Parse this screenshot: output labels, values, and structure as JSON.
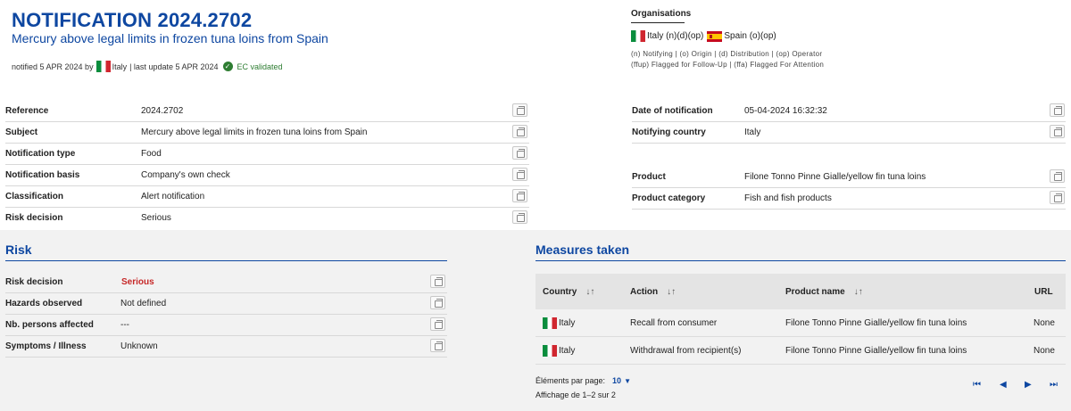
{
  "header": {
    "title": "NOTIFICATION 2024.2702",
    "subtitle": "Mercury above legal limits in frozen tuna loins from Spain",
    "notified_prefix": "notified 5 APR 2024 by",
    "notified_country": "Italy",
    "last_update": "| last update 5 APR 2024",
    "ec_validated": "EC validated"
  },
  "organisations": {
    "title": "Organisations",
    "entries": [
      {
        "country": "Italy",
        "roles": "(n)(d)(op)"
      },
      {
        "country": "Spain",
        "roles": "(o)(op)"
      }
    ],
    "legend_line1": "(n) Notifying | (o) Origin | (d) Distribution | (op) Operator",
    "legend_line2": "(ffup) Flagged for Follow-Up | (ffa) Flagged For Attention"
  },
  "details_left": [
    {
      "label": "Reference",
      "value": "2024.2702"
    },
    {
      "label": "Subject",
      "value": "Mercury above legal limits in frozen tuna loins from Spain"
    },
    {
      "label": "Notification type",
      "value": "Food"
    },
    {
      "label": "Notification basis",
      "value": "Company's own check"
    },
    {
      "label": "Classification",
      "value": "Alert notification"
    },
    {
      "label": "Risk decision",
      "value": "Serious"
    }
  ],
  "details_right": [
    {
      "label": "Date of notification",
      "value": "05-04-2024 16:32:32"
    },
    {
      "label": "Notifying country",
      "value": "Italy"
    },
    {
      "label": "Product",
      "value": "Filone Tonno Pinne Gialle/yellow fin tuna loins"
    },
    {
      "label": "Product category",
      "value": "Fish and fish products"
    }
  ],
  "risk": {
    "title": "Risk",
    "rows": [
      {
        "label": "Risk decision",
        "value": "Serious"
      },
      {
        "label": "Hazards observed",
        "value": "Not defined"
      },
      {
        "label": "Nb. persons affected",
        "value": "---"
      },
      {
        "label": "Symptoms / Illness",
        "value": "Unknown"
      }
    ]
  },
  "measures": {
    "title": "Measures taken",
    "columns": [
      "Country",
      "Action",
      "Product name",
      "URL"
    ],
    "rows": [
      {
        "country": "Italy",
        "action": "Recall from consumer",
        "product": "Filone Tonno Pinne Gialle/yellow fin tuna loins",
        "url": "None"
      },
      {
        "country": "Italy",
        "action": "Withdrawal from recipient(s)",
        "product": "Filone Tonno Pinne Gialle/yellow fin tuna loins",
        "url": "None"
      }
    ],
    "page_size_label": "Éléments par page:",
    "page_size_value": "10",
    "range_label": "Affichage de 1–2 sur 2"
  },
  "colors": {
    "accent": "#0e47a1",
    "serious": "#c62828",
    "validated": "#2e7d32"
  }
}
